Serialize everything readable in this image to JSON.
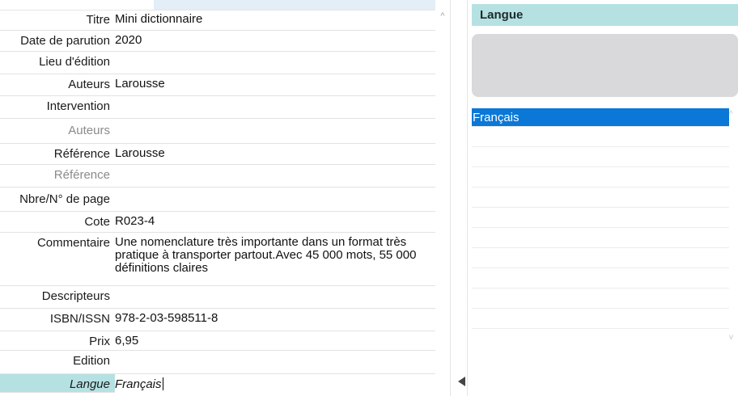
{
  "form": {
    "fields": [
      {
        "label": "Titre",
        "value": "Mini dictionnaire"
      },
      {
        "label": "Date de parution",
        "value": "2020"
      },
      {
        "label": "Lieu d'édition",
        "value": ""
      },
      {
        "label": "Auteurs",
        "value": "Larousse"
      },
      {
        "label": "Intervention",
        "value": ""
      },
      {
        "label": "Auteurs",
        "value": ""
      },
      {
        "label": "Référence",
        "value": "Larousse"
      },
      {
        "label": "Référence",
        "value": ""
      },
      {
        "label": "Nbre/N° de page",
        "value": ""
      },
      {
        "label": "Cote",
        "value": "R023-4"
      },
      {
        "label": "Commentaire",
        "value": "Une nomenclature très importante dans un format très pratique à transporter partout.Avec 45 000 mots, 55 000 définitions claires"
      },
      {
        "label": "Descripteurs",
        "value": ""
      },
      {
        "label": "ISBN/ISSN",
        "value": "978-2-03-598511-8"
      },
      {
        "label": "Prix",
        "value": "6,95"
      },
      {
        "label": "Edition",
        "value": ""
      },
      {
        "label": "Langue",
        "value": "Français"
      }
    ]
  },
  "right": {
    "header": "Langue",
    "list": [
      "Français",
      "",
      "",
      "",
      "",
      "",
      "",
      "",
      "",
      "",
      "",
      ""
    ]
  },
  "colors": {
    "accent_teal": "#b5e1e3",
    "selection_blue": "#0b78d7"
  }
}
